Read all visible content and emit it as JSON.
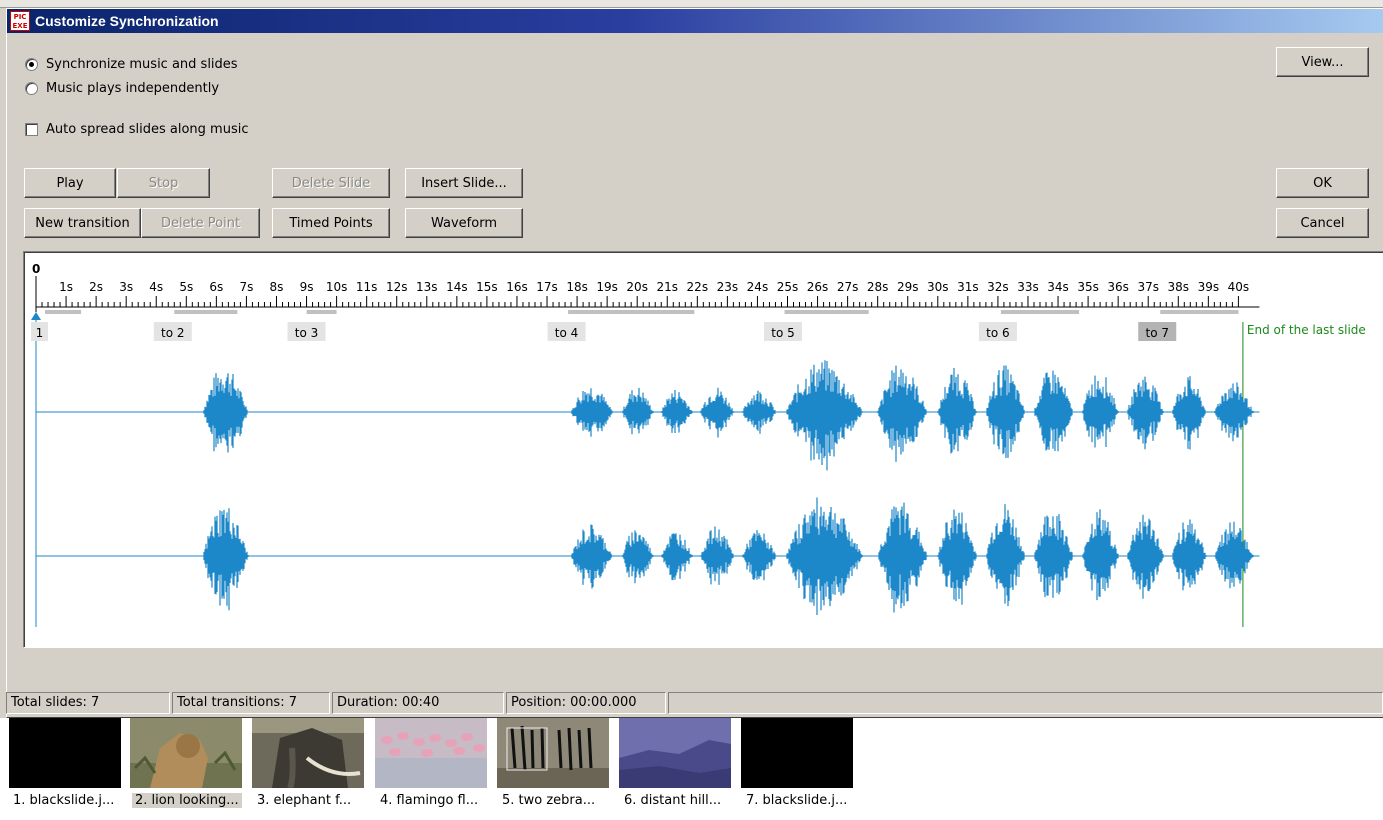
{
  "dialog": {
    "title": "Customize Synchronization",
    "app_icon": "PIC EXE"
  },
  "options": {
    "sync_label": "Synchronize music and slides",
    "independent_label": "Music plays independently",
    "sync_selected": true,
    "auto_spread_label": "Auto spread slides along music",
    "auto_spread_checked": false
  },
  "buttons": {
    "play": "Play",
    "stop": "Stop",
    "delete_slide": "Delete Slide",
    "insert_slide": "Insert Slide...",
    "new_transition": "New transition",
    "delete_point": "Delete Point",
    "timed_points": "Timed Points",
    "waveform": "Waveform",
    "view": "View...",
    "ok": "OK",
    "cancel": "Cancel"
  },
  "timeline": {
    "zero_label": "0",
    "ticks": [
      "1s",
      "2s",
      "3s",
      "4s",
      "5s",
      "6s",
      "7s",
      "8s",
      "9s",
      "10s",
      "11s",
      "12s",
      "13s",
      "14s",
      "15s",
      "16s",
      "17s",
      "18s",
      "19s",
      "20s",
      "21s",
      "22s",
      "23s",
      "24s",
      "25s",
      "26s",
      "27s",
      "28s",
      "29s",
      "30s",
      "31s",
      "32s",
      "33s",
      "34s",
      "35s",
      "36s",
      "37s",
      "38s",
      "39s",
      "40s"
    ],
    "transition_markers": [
      {
        "label": "1",
        "time_s": 0.0,
        "selected": false
      },
      {
        "label": "to 2",
        "time_s": 4.55,
        "selected": false
      },
      {
        "label": "to 3",
        "time_s": 9.0,
        "selected": false
      },
      {
        "label": "to 4",
        "time_s": 17.65,
        "selected": false
      },
      {
        "label": "to 5",
        "time_s": 24.85,
        "selected": false
      },
      {
        "label": "to 6",
        "time_s": 32.0,
        "selected": false
      },
      {
        "label": "to 7",
        "time_s": 37.3,
        "selected": true
      }
    ],
    "end_label": "End of the last slide",
    "end_time_s": 40.15,
    "colors": {
      "waveform": "#1c87c9",
      "end_marker": "#1a8a1a",
      "selected_marker": "#b4b4b4",
      "marker_bg": "#e4e4e4"
    }
  },
  "status": {
    "total_slides": "Total slides: 7",
    "total_transitions": "Total transitions: 7",
    "duration": "Duration: 00:40",
    "position": "Position: 00:00.000"
  },
  "slides": [
    {
      "label": "1. blackslide.j...",
      "image": "black slide",
      "selected": false
    },
    {
      "label": "2. lion looking...",
      "image": "lion",
      "selected": true
    },
    {
      "label": "3. elephant f...",
      "image": "elephant",
      "selected": false
    },
    {
      "label": "4. flamingo fl...",
      "image": "flamingos",
      "selected": false
    },
    {
      "label": "5. two zebra...",
      "image": "zebras",
      "selected": false
    },
    {
      "label": "6. distant hill...",
      "image": "distant hills",
      "selected": false
    },
    {
      "label": "7. blackslide.j...",
      "image": "black slide",
      "selected": false
    }
  ]
}
